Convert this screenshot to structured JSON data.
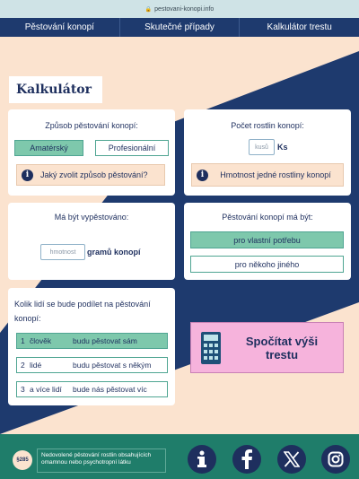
{
  "browser": {
    "url": "pestovani-konopi.info"
  },
  "nav": {
    "tabs": [
      "Pěstování konopí",
      "Skutečné případy",
      "Kalkulátor trestu"
    ]
  },
  "page_title": "Kalkulátor",
  "colors": {
    "navy": "#1e2f5e",
    "green": "#7ec8ac",
    "peach": "#fbe3cf",
    "pink": "#f6b3dc",
    "teal": "#1f7d6a"
  },
  "method": {
    "title": "Způsob pěstování konopí:",
    "options": [
      "Amatérský",
      "Profesionální"
    ],
    "selected": "Amatérský",
    "help": "Jaký zvolit způsob pěstování?"
  },
  "plants": {
    "title": "Počet rostlin konopí:",
    "placeholder": "kusů",
    "unit": "Ks",
    "help": "Hmotnost jedné rostliny konopí"
  },
  "grown": {
    "title": "Má být vypěstováno:",
    "placeholder": "hmotnost",
    "unit": "gramů konopí"
  },
  "purpose": {
    "title": "Pěstování konopí má být:",
    "options": [
      "pro vlastní potřebu",
      "pro někoho jiného"
    ],
    "selected": "pro vlastní potřebu"
  },
  "people": {
    "title": "Kolik lidí se bude podílet na pěstování konopí:",
    "rows": [
      {
        "num": "1",
        "who": "člověk",
        "desc": "budu pěstovat sám"
      },
      {
        "num": "2",
        "who": "lidé",
        "desc": "budu pěstovat s někým"
      },
      {
        "num": "3",
        "who": "a více lidí",
        "desc": "bude nás pěstovat víc"
      }
    ],
    "selected_index": 0
  },
  "calculate": {
    "label": "Spočítat výši trestu",
    "icon": "calculator-icon"
  },
  "footer": {
    "logo": "§285",
    "disclaimer": "Nedovolené pěstování rostlin obsahujících omamnou nebo psychotropní látku",
    "social": [
      "info-icon",
      "facebook-icon",
      "x-icon",
      "instagram-icon"
    ]
  }
}
